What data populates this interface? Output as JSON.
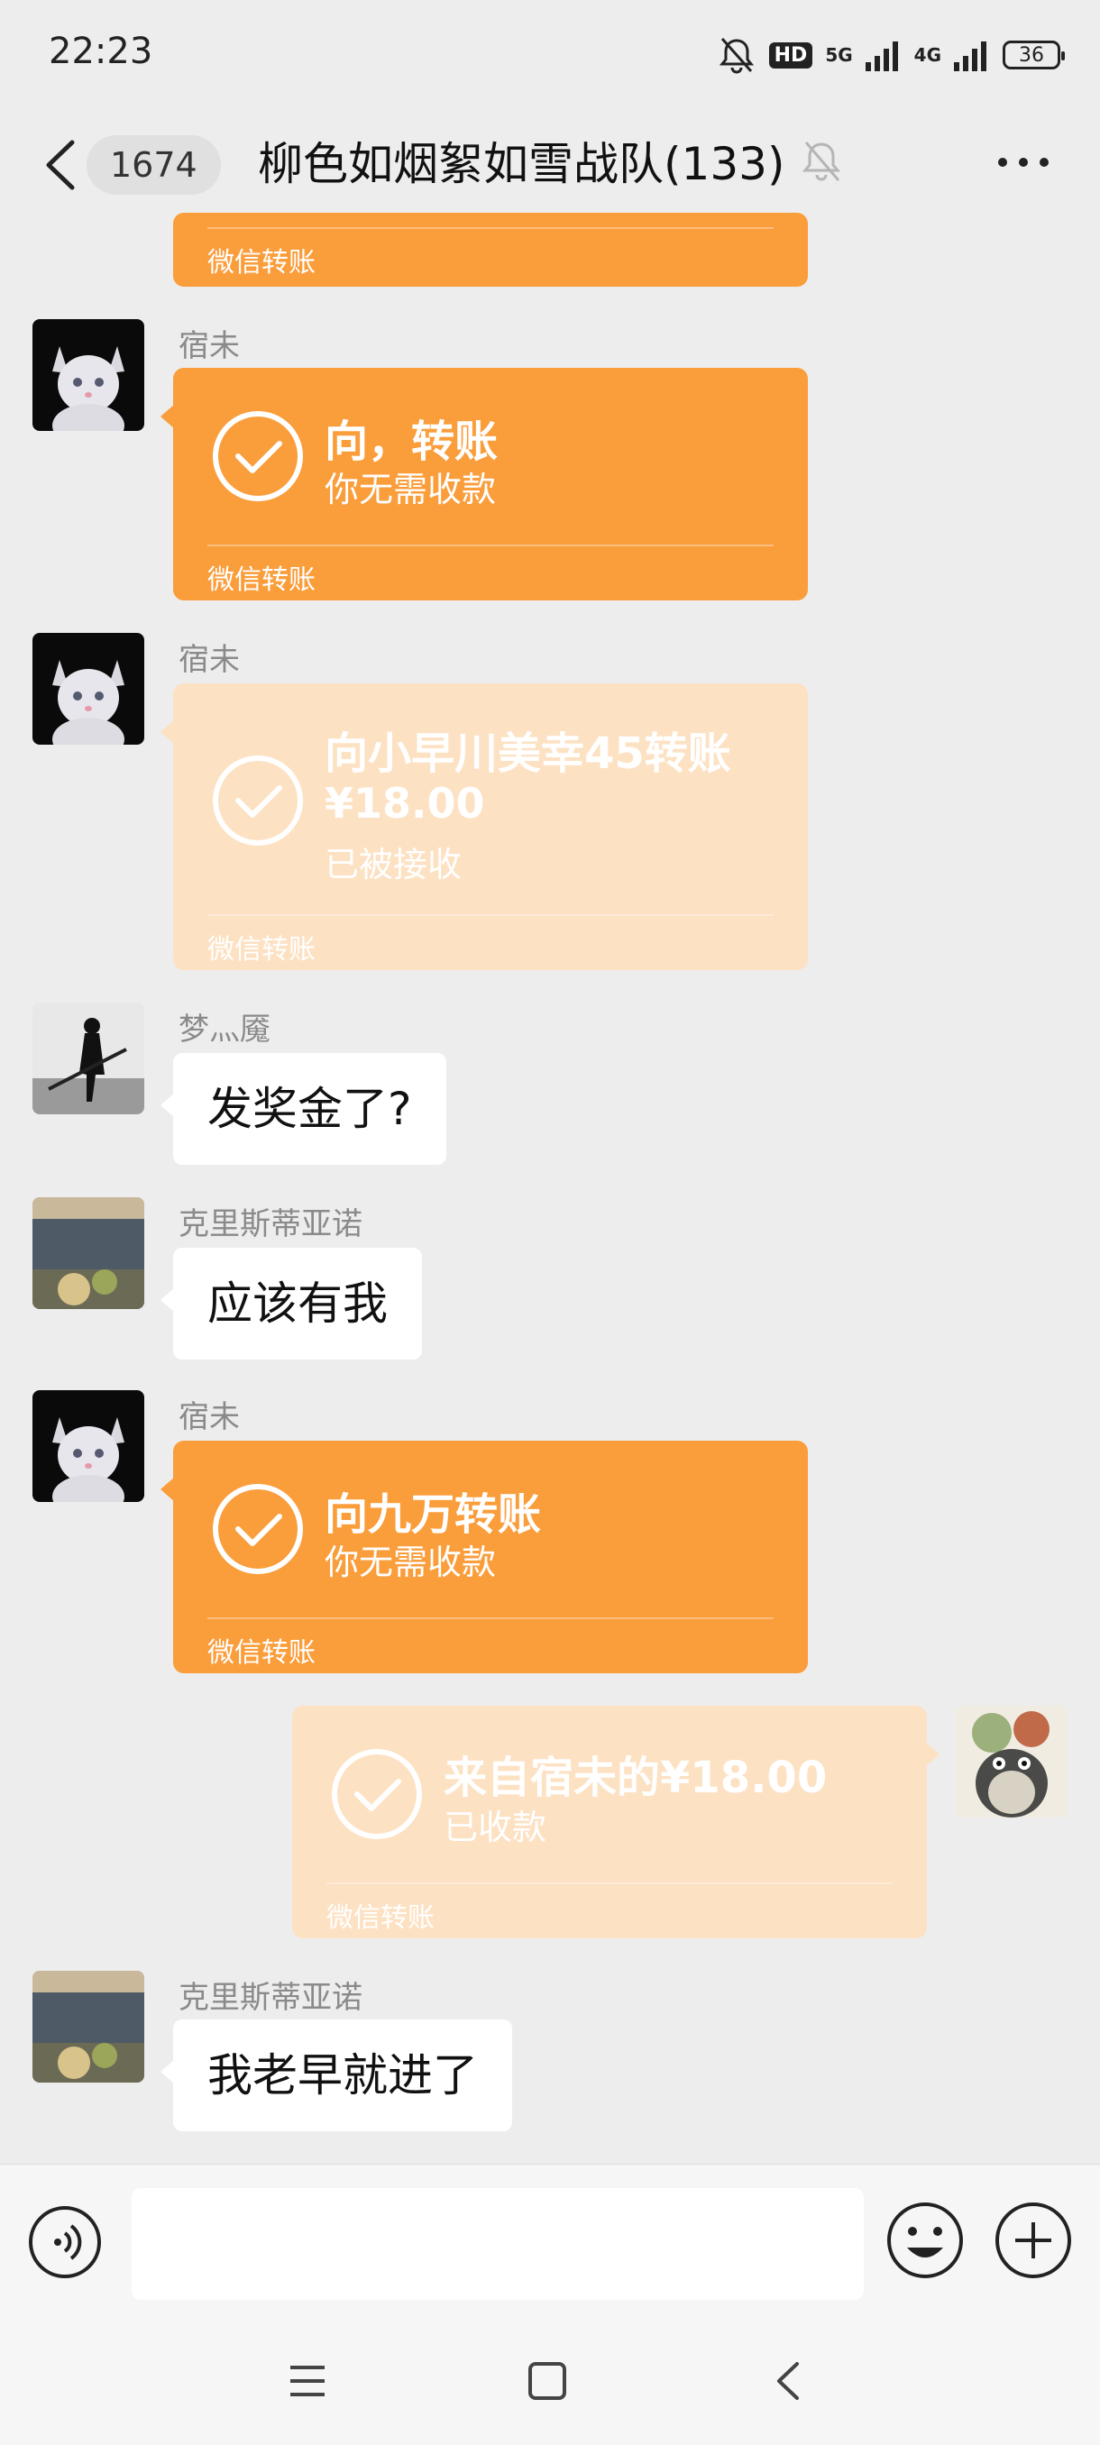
{
  "status_bar": {
    "time": "22:23",
    "hd": "HD",
    "net_5g": "5G",
    "net_4g": "4G",
    "battery": "36",
    "icons": [
      "bell-off-icon",
      "hd-icon",
      "signal-5g-icon",
      "signal-4g-icon",
      "battery-icon"
    ]
  },
  "header": {
    "unread_count": "1674",
    "title": "柳色如烟絮如雪战队(133)",
    "icons": [
      "back-chevron-icon",
      "muted-bell-icon",
      "more-dots-icon"
    ]
  },
  "colors": {
    "transfer_active": "#fa9d3b",
    "transfer_done": "#fde1c3",
    "chat_background": "#ededed"
  },
  "messages": [
    {
      "type": "transfer_partial",
      "footer": "微信转账"
    },
    {
      "sender": "宿未",
      "type": "transfer",
      "status": "active",
      "title": "向，转账",
      "subtitle": "你无需收款",
      "footer": "微信转账"
    },
    {
      "sender": "宿未",
      "type": "transfer",
      "status": "done",
      "title": "向小早川美幸45转账",
      "amount": "¥18.00",
      "subtitle": "已被接收",
      "footer": "微信转账"
    },
    {
      "sender": "梦灬魇",
      "type": "text",
      "text": "发奖金了?"
    },
    {
      "sender": "克里斯蒂亚诺",
      "type": "text",
      "text": "应该有我"
    },
    {
      "sender": "宿未",
      "type": "transfer",
      "status": "active",
      "title": "向九万转账",
      "subtitle": "你无需收款",
      "footer": "微信转账"
    },
    {
      "sender": "",
      "type": "transfer",
      "status": "done",
      "outgoing": true,
      "title": "来自宿未的¥18.00",
      "subtitle": "已收款",
      "footer": "微信转账"
    },
    {
      "sender": "克里斯蒂亚诺",
      "type": "text",
      "text": "我老早就进了"
    }
  ],
  "input_bar": {
    "placeholder": "",
    "icons": [
      "voice-icon",
      "emoji-icon",
      "plus-icon"
    ]
  },
  "system_nav": {
    "icons": [
      "menu-icon",
      "home-icon",
      "back-icon"
    ]
  }
}
